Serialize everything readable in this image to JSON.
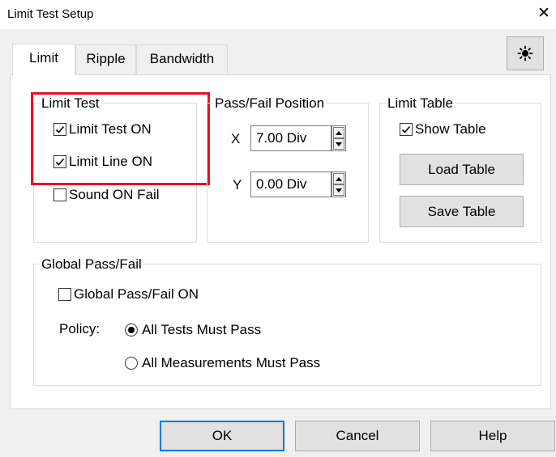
{
  "window": {
    "title": "Limit Test Setup",
    "close_icon": "close-icon"
  },
  "tabs": [
    {
      "label": "Limit",
      "active": true
    },
    {
      "label": "Ripple",
      "active": false
    },
    {
      "label": "Bandwidth",
      "active": false
    }
  ],
  "toolbar": {
    "theme_icon": "sun-icon"
  },
  "limit_test": {
    "legend": "Limit Test",
    "limit_test_on": {
      "label": "Limit Test ON",
      "checked": true
    },
    "limit_line_on": {
      "label": "Limit Line ON",
      "checked": true
    },
    "sound_on_fail": {
      "label": "Sound ON Fail",
      "checked": false
    }
  },
  "pass_fail_position": {
    "legend": "Pass/Fail Position",
    "x": {
      "label": "X",
      "value": "7.00 Div"
    },
    "y": {
      "label": "Y",
      "value": "0.00 Div"
    }
  },
  "limit_table": {
    "legend": "Limit Table",
    "show_table": {
      "label": "Show Table",
      "checked": true
    },
    "load_label": "Load Table",
    "save_label": "Save Table"
  },
  "global": {
    "legend": "Global Pass/Fail",
    "global_on": {
      "label": "Global Pass/Fail ON",
      "checked": false
    },
    "policy_label": "Policy:",
    "options": [
      {
        "label": "All Tests Must Pass",
        "selected": true
      },
      {
        "label": "All Measurements Must Pass",
        "selected": false
      }
    ]
  },
  "buttons": {
    "ok": "OK",
    "cancel": "Cancel",
    "help": "Help"
  },
  "colors": {
    "highlight": "#e81123",
    "focus": "#0078d7",
    "button_face": "#e1e1e1"
  }
}
